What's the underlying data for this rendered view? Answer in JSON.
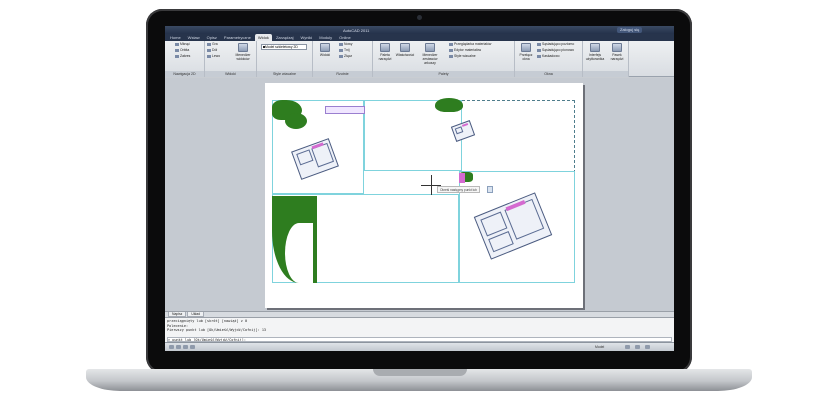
{
  "window": {
    "app_title": "AutoCAD 2011",
    "login_label": "Zaloguj się"
  },
  "tabs": [
    "Home",
    "Wstaw",
    "Opisz",
    "Parametryczne",
    "Widok",
    "Zarządzaj",
    "Wyniki",
    "Moduły",
    "Online"
  ],
  "ribbon": {
    "nav_panel": {
      "items": [
        "Mknąć",
        "Orbita",
        "Zakres"
      ],
      "label": "Nawigacja 2D"
    },
    "views_panel": {
      "items": [
        "Gra",
        "Dół",
        "Lewo"
      ],
      "big_label": "Menedżer widoków",
      "label": "Widoki"
    },
    "visual_styles_panel": {
      "dropdown_value": "Model szkieletowy 2D",
      "label": "Style wizualne"
    },
    "models_panel": {
      "big_label": "Widoki",
      "items": [
        "Nowy",
        "Tnij",
        "Złącz"
      ],
      "label": "Rzutnie"
    },
    "palettes_panel": {
      "big_items": [
        "Paleta narzędzi",
        "Właściwości",
        "Menedżer zestawów arkuszy"
      ],
      "small_items": [
        "Przeglądarka materiałów",
        "Edytor materiałów",
        "Style wizualne"
      ],
      "label": "Palety"
    },
    "windows_panel": {
      "big_label": "Przełącz okna",
      "small_items": [
        "Sąsiadująco poziomo",
        "Sąsiadująco pionowo",
        "Kaskadowo"
      ],
      "label": "Okna"
    },
    "ui_panel": {
      "big_items": [
        "Interfejs użytkownika",
        "Pasek narzędzi"
      ],
      "label": ""
    }
  },
  "canvas": {
    "tooltip": "Określ następny punkt lub"
  },
  "layout_tabs": [
    "Napisz",
    "Układ"
  ],
  "command_lines": [
    "przeciągnięty lub [skrót] [nawiąż] z 0",
    "Polecenie: ",
    "Pierwszy punkt lub [Ok/Umieść/Wyjdź/Cofnij]: 13",
    "",
    "> punkt lub [Ok/Umieść/Wyjdź/Cofnij]:"
  ],
  "status": {
    "coords": "Model"
  }
}
